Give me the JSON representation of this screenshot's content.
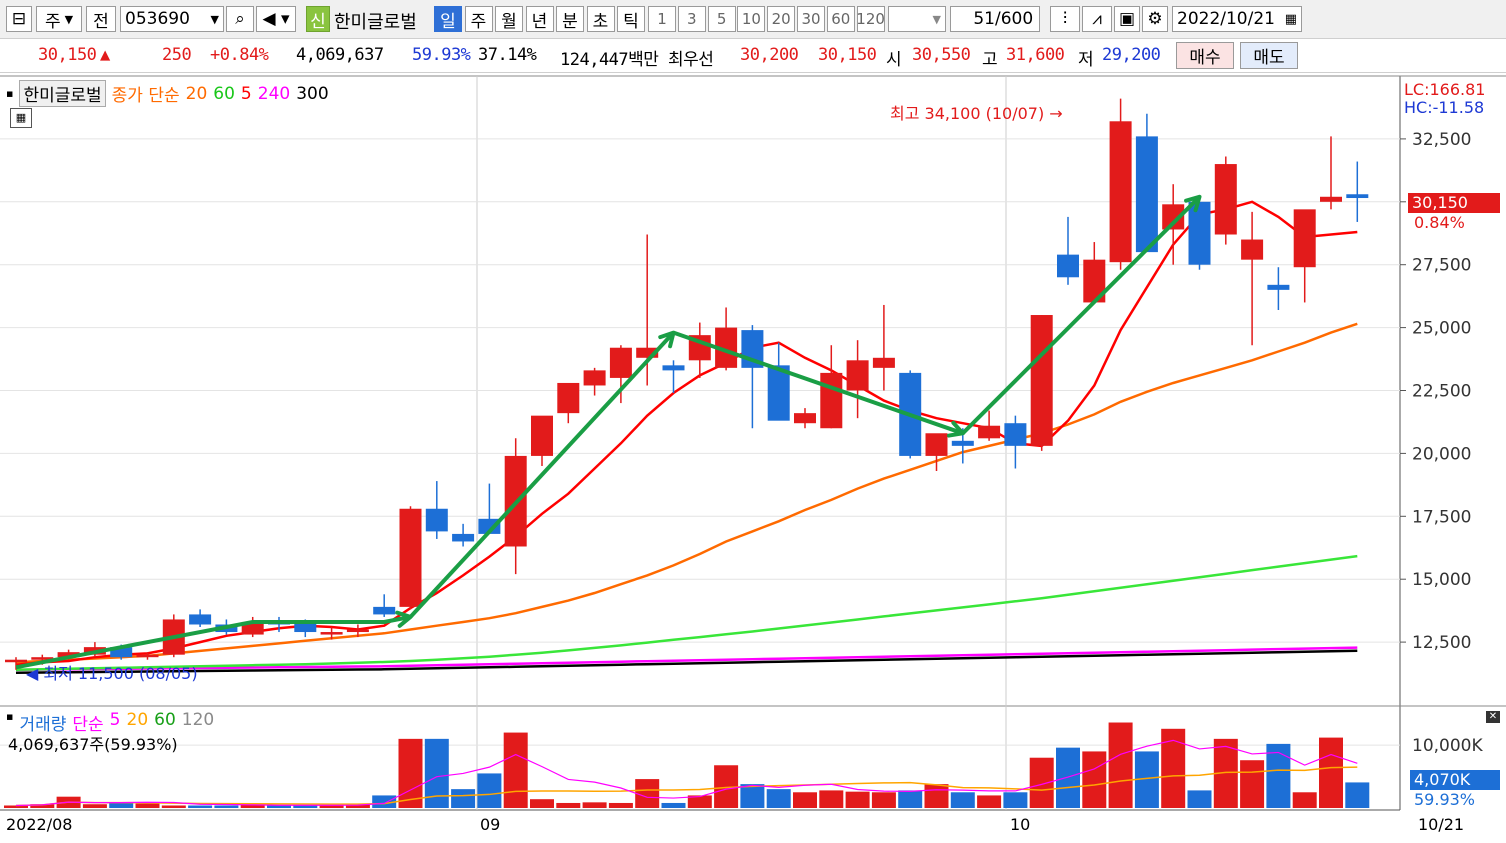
{
  "toolbar": {
    "period_unit": "주",
    "prev_label": "전",
    "code": "053690",
    "new_badge": "신",
    "stock_name": "한미글로벌",
    "periods": [
      "일",
      "주",
      "월",
      "년",
      "분",
      "초",
      "틱"
    ],
    "active_period": "일",
    "intervals": [
      "1",
      "3",
      "5",
      "10",
      "20",
      "30",
      "60",
      "120"
    ],
    "count": "51",
    "count_max": "/600",
    "date": "2022/10/21"
  },
  "quote": {
    "price": "30,150",
    "change": "250",
    "change_pct": "+0.84%",
    "volume": "4,069,637",
    "vol_ratio": "59.93%",
    "turnover": "37.14%",
    "amount": "124,447백만",
    "best_label": "최우선",
    "ask": "30,200",
    "bid": "30,150",
    "open_label": "시",
    "open": "30,550",
    "high_label": "고",
    "high": "31,600",
    "low_label": "저",
    "low": "29,200",
    "buy_label": "매수",
    "sell_label": "매도"
  },
  "legend": {
    "name": "한미글로벌",
    "price_label": "종가 단순",
    "ma": [
      "20",
      "60",
      "5",
      "240",
      "300"
    ],
    "ma_colors": [
      "#ff6a00",
      "#19c719",
      "#ff0000",
      "#ff00ff",
      "#000000"
    ]
  },
  "right_info": {
    "lc": "LC:166.81",
    "hc": "HC:-11.58",
    "last": "30,150",
    "last_pct": "0.84%"
  },
  "annotations": {
    "high": "최고 34,100 (10/07) →",
    "low": "◀ 최저 11,500 (08/05)"
  },
  "volume_legend": {
    "title": "거래량",
    "type": "단순",
    "ma": [
      "5",
      "20",
      "60",
      "120"
    ],
    "ma_colors": [
      "#ff00ff",
      "#ffa500",
      "#19a019",
      "#8a8a8a"
    ],
    "value": "4,069,637주(59.93%)",
    "last": "4,070K",
    "last_pct": "59.93%"
  },
  "x_labels": [
    "2022/08",
    "09",
    "10",
    "10/21"
  ],
  "chart_data": {
    "type": "candlestick",
    "ylim": [
      10000,
      35000
    ],
    "y_ticks": [
      "12,500",
      "15,000",
      "17,500",
      "20,000",
      "22,500",
      "25,000",
      "27,500",
      "30,000",
      "32,500"
    ],
    "volume_ticks": [
      "10,000K"
    ],
    "candles": [
      [
        11700,
        11900,
        11400,
        11800
      ],
      [
        11800,
        12000,
        11600,
        11900
      ],
      [
        11900,
        12200,
        11800,
        12100
      ],
      [
        12000,
        12500,
        11900,
        12300
      ],
      [
        12300,
        12400,
        11800,
        11900
      ],
      [
        11900,
        12100,
        11800,
        12000
      ],
      [
        12000,
        13600,
        11900,
        13400
      ],
      [
        13600,
        13800,
        13100,
        13200
      ],
      [
        13200,
        13400,
        12800,
        12900
      ],
      [
        12800,
        13500,
        12700,
        13300
      ],
      [
        13300,
        13500,
        12900,
        13200
      ],
      [
        13300,
        13400,
        12700,
        12900
      ],
      [
        12800,
        13100,
        12600,
        12900
      ],
      [
        12900,
        13200,
        12700,
        13000
      ],
      [
        13900,
        14400,
        13500,
        13600
      ],
      [
        13900,
        17900,
        13800,
        17800
      ],
      [
        17800,
        18900,
        16600,
        16900
      ],
      [
        16800,
        17200,
        16300,
        16500
      ],
      [
        17400,
        18800,
        16900,
        16800
      ],
      [
        16300,
        20600,
        15200,
        19900
      ],
      [
        19900,
        21200,
        19500,
        21500
      ],
      [
        21600,
        22600,
        21200,
        22800
      ],
      [
        22700,
        23400,
        22300,
        23300
      ],
      [
        23000,
        24300,
        22000,
        24200
      ],
      [
        23800,
        28700,
        22700,
        24200
      ],
      [
        23500,
        23700,
        22400,
        23300
      ],
      [
        23700,
        25200,
        23000,
        24700
      ],
      [
        23400,
        25800,
        23300,
        25000
      ],
      [
        24900,
        25100,
        21000,
        23400
      ],
      [
        23500,
        24400,
        21600,
        21300
      ],
      [
        21200,
        21800,
        21000,
        21600
      ],
      [
        21000,
        24300,
        21000,
        23200
      ],
      [
        22500,
        24500,
        21400,
        23700
      ],
      [
        23400,
        25900,
        22500,
        23800
      ],
      [
        23200,
        23300,
        19800,
        19900
      ],
      [
        19900,
        20700,
        19300,
        20800
      ],
      [
        20500,
        21000,
        19600,
        20300
      ],
      [
        20600,
        21700,
        20500,
        21100
      ],
      [
        21200,
        21500,
        19400,
        20300
      ],
      [
        20300,
        25500,
        20100,
        25500
      ],
      [
        27900,
        29400,
        26700,
        27000
      ],
      [
        26000,
        28400,
        26000,
        27700
      ],
      [
        27600,
        34100,
        27300,
        33200
      ],
      [
        32600,
        33500,
        29700,
        28000
      ],
      [
        28900,
        30700,
        27500,
        29900
      ],
      [
        30000,
        29900,
        27300,
        27500
      ],
      [
        28700,
        31800,
        28300,
        31500
      ],
      [
        27700,
        29600,
        24300,
        28500
      ],
      [
        26700,
        27400,
        25700,
        26500
      ],
      [
        27400,
        29600,
        26000,
        29700
      ],
      [
        30000,
        32600,
        29700,
        30200
      ],
      [
        30300,
        31600,
        29200,
        30150
      ]
    ],
    "ma5": [
      11600,
      11700,
      11750,
      11900,
      12000,
      12050,
      12250,
      12500,
      12750,
      12900,
      13050,
      13150,
      13100,
      13000,
      13150,
      13850,
      14450,
      15150,
      15900,
      16700,
      17600,
      18400,
      19400,
      20400,
      21500,
      22400,
      23100,
      23600,
      24200,
      24400,
      23800,
      23300,
      22700,
      22100,
      21700,
      21400,
      21200,
      21000,
      20400,
      20300,
      21300,
      22700,
      24900,
      26600,
      28300,
      29500,
      29700,
      30000,
      29400,
      28600,
      28700,
      28800
    ],
    "ma20": [
      11700,
      11750,
      11800,
      11850,
      11900,
      11950,
      12050,
      12150,
      12250,
      12350,
      12450,
      12550,
      12650,
      12750,
      12850,
      13000,
      13150,
      13300,
      13450,
      13650,
      13900,
      14150,
      14450,
      14800,
      15150,
      15550,
      16000,
      16500,
      16900,
      17300,
      17750,
      18150,
      18600,
      19000,
      19350,
      19700,
      20050,
      20300,
      20550,
      20800,
      21150,
      21550,
      22050,
      22450,
      22800,
      23100,
      23400,
      23700,
      24050,
      24400,
      24800,
      25150
    ],
    "ma60": [
      11400,
      11420,
      11440,
      11460,
      11480,
      11500,
      11520,
      11540,
      11560,
      11580,
      11600,
      11620,
      11650,
      11680,
      11710,
      11750,
      11800,
      11860,
      11920,
      12000,
      12080,
      12170,
      12270,
      12370,
      12480,
      12590,
      12700,
      12810,
      12920,
      13040,
      13160,
      13280,
      13400,
      13520,
      13640,
      13760,
      13880,
      14000,
      14120,
      14240,
      14380,
      14520,
      14660,
      14800,
      14940,
      15080,
      15220,
      15360,
      15500,
      15640,
      15780,
      15920
    ],
    "ma240": [
      11400,
      11410,
      11420,
      11430,
      11440,
      11450,
      11460,
      11470,
      11480,
      11490,
      11500,
      11510,
      11520,
      11530,
      11540,
      11560,
      11580,
      11600,
      11620,
      11640,
      11660,
      11680,
      11700,
      11720,
      11740,
      11760,
      11780,
      11800,
      11820,
      11840,
      11860,
      11880,
      11900,
      11920,
      11940,
      11960,
      11980,
      12000,
      12020,
      12040,
      12060,
      12080,
      12100,
      12120,
      12140,
      12160,
      12180,
      12200,
      12220,
      12240,
      12260,
      12280
    ],
    "volume_k": [
      40,
      60,
      180,
      60,
      90,
      70,
      40,
      40,
      40,
      60,
      40,
      40,
      40,
      50,
      200,
      1100,
      1100,
      300,
      550,
      1200,
      140,
      80,
      90,
      80,
      460,
      80,
      200,
      680,
      380,
      300,
      250,
      280,
      260,
      250,
      280,
      380,
      250,
      200,
      250,
      800,
      960,
      900,
      1360,
      900,
      1260,
      280,
      1100,
      760,
      1020,
      250,
      1120,
      407
    ],
    "trend_lines": [
      [
        [
          0,
          11500
        ],
        [
          9,
          13300
        ],
        [
          14,
          13300
        ],
        [
          15,
          13500
        ]
      ],
      [
        [
          15,
          13500
        ],
        [
          25,
          24800
        ]
      ],
      [
        [
          25,
          24800
        ],
        [
          36,
          20800
        ]
      ],
      [
        [
          36,
          20800
        ],
        [
          45,
          30200
        ]
      ]
    ]
  }
}
